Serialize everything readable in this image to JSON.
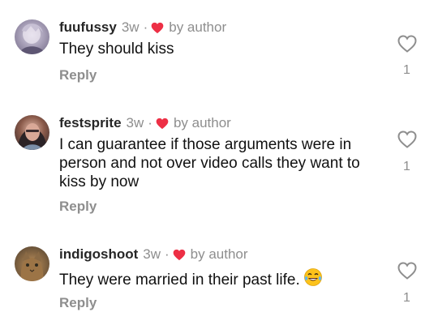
{
  "comments": [
    {
      "username": "fuufussy",
      "time": "3w",
      "dot": "·",
      "liked_by": "by author",
      "text": "They should kiss",
      "reply": "Reply",
      "likes": "1"
    },
    {
      "username": "festsprite",
      "time": "3w",
      "dot": "·",
      "liked_by": "by author",
      "text": "I can guarantee if those arguments were in person and not over video calls they want to kiss by now",
      "reply": "Reply",
      "likes": "1"
    },
    {
      "username": "indigoshoot",
      "time": "3w",
      "dot": "·",
      "liked_by": "by author",
      "text": "They were married in their past life.",
      "emoji": "face-with-tears-of-joy",
      "reply": "Reply",
      "likes": "1"
    }
  ],
  "colors": {
    "author_heart": "#ed2f45",
    "muted": "#8e8e8e",
    "text": "#111111"
  }
}
